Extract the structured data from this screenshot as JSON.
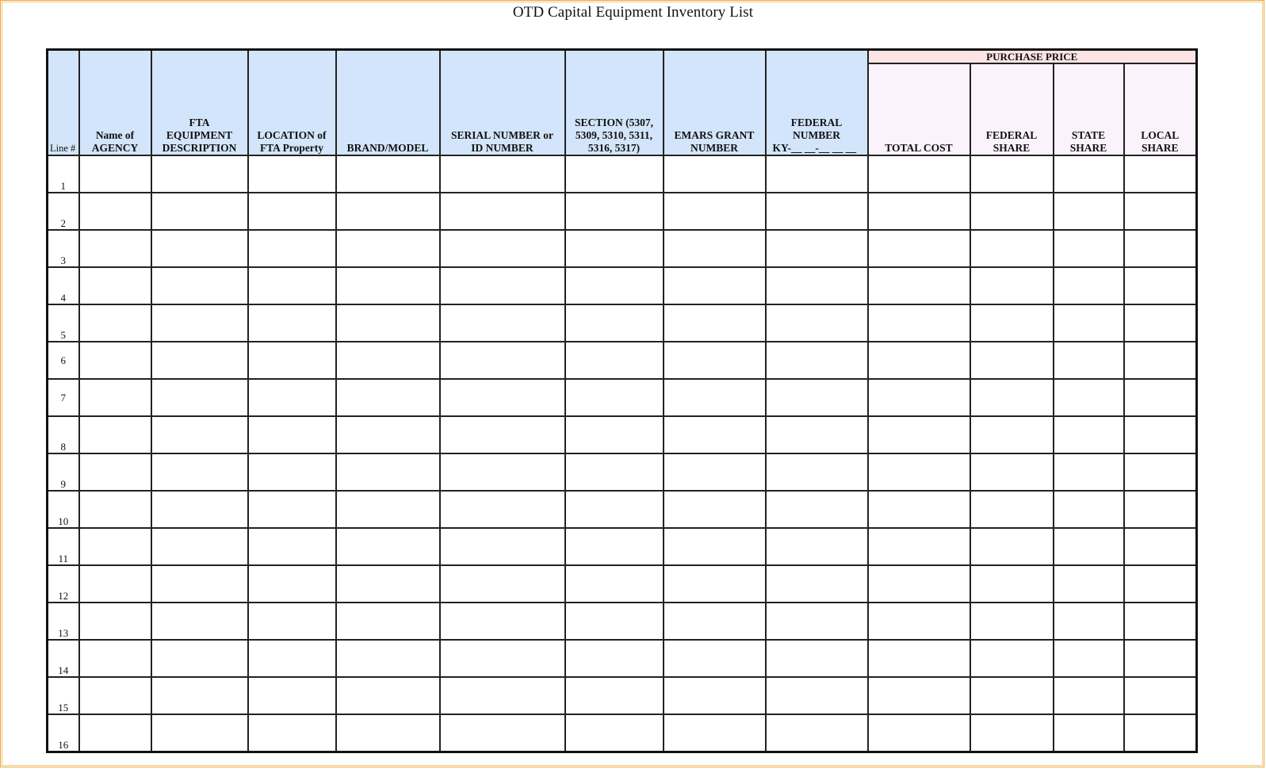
{
  "document": {
    "title": "OTD Capital Equipment Inventory List"
  },
  "table": {
    "columns": [
      {
        "key": "line",
        "label_lines": [
          "Line #"
        ]
      },
      {
        "key": "agency",
        "label_lines": [
          "Name of",
          "AGENCY"
        ]
      },
      {
        "key": "fta_description",
        "label_lines": [
          "FTA",
          "EQUIPMENT",
          "DESCRIPTION"
        ]
      },
      {
        "key": "location",
        "label_lines": [
          "LOCATION of",
          "FTA Property"
        ]
      },
      {
        "key": "brand_model",
        "label_lines": [
          "BRAND/MODEL"
        ]
      },
      {
        "key": "serial",
        "label_lines": [
          "SERIAL NUMBER or",
          "ID NUMBER"
        ]
      },
      {
        "key": "section",
        "label_lines": [
          "SECTION (5307,",
          "5309, 5310, 5311,",
          "5316, 5317)"
        ]
      },
      {
        "key": "emars",
        "label_lines": [
          "EMARS GRANT",
          "NUMBER"
        ]
      },
      {
        "key": "federal_number",
        "label_lines": [
          "FEDERAL",
          "NUMBER",
          "KY-__ __-__ __ __"
        ]
      }
    ],
    "purchase_price": {
      "group_label": "PURCHASE PRICE",
      "columns": [
        {
          "key": "total_cost",
          "label_lines": [
            "TOTAL COST"
          ]
        },
        {
          "key": "federal_share",
          "label_lines": [
            "FEDERAL",
            "SHARE"
          ]
        },
        {
          "key": "state_share",
          "label_lines": [
            "STATE",
            "SHARE"
          ]
        },
        {
          "key": "local_share",
          "label_lines": [
            "LOCAL",
            "SHARE"
          ]
        }
      ]
    },
    "rows": [
      {
        "line": "1"
      },
      {
        "line": "2"
      },
      {
        "line": "3"
      },
      {
        "line": "4"
      },
      {
        "line": "5"
      },
      {
        "line": "6"
      },
      {
        "line": "7"
      },
      {
        "line": "8"
      },
      {
        "line": "9"
      },
      {
        "line": "10"
      },
      {
        "line": "11"
      },
      {
        "line": "12"
      },
      {
        "line": "13"
      },
      {
        "line": "14"
      },
      {
        "line": "15"
      },
      {
        "line": "16"
      }
    ]
  }
}
